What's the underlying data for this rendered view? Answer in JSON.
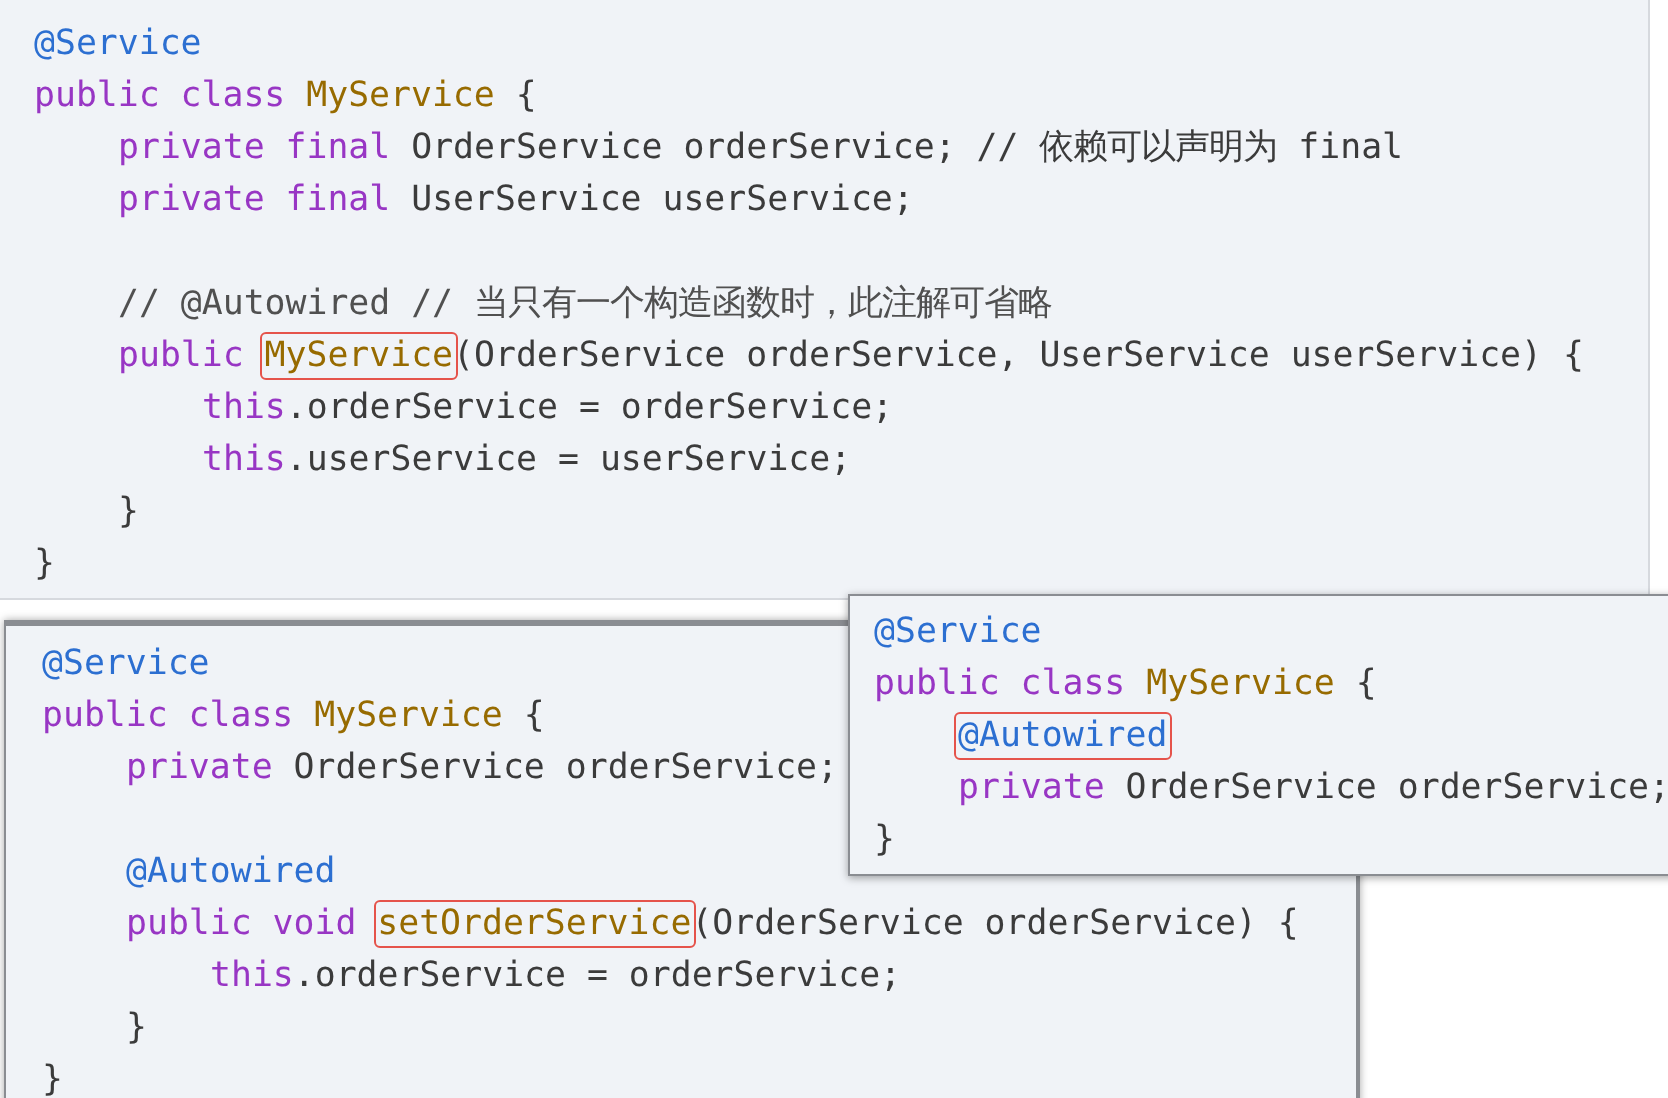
{
  "panels": [
    {
      "lines": [
        {
          "kind": "code",
          "tokens": [
            {
              "text": "@Service",
              "kind": "annotation"
            }
          ]
        },
        {
          "kind": "code",
          "tokens": [
            {
              "text": "public class ",
              "kind": "keyword"
            },
            {
              "text": "MyService",
              "kind": "type"
            },
            {
              "text": " {",
              "kind": "plain"
            }
          ],
          "children": [
            {
              "kind": "code",
              "tokens": [
                {
                  "text": "private final ",
                  "kind": "keyword"
                },
                {
                  "text": "OrderService orderService; // 依赖可以声明为 final",
                  "kind": "plain"
                }
              ]
            },
            {
              "kind": "code",
              "tokens": [
                {
                  "text": "private final ",
                  "kind": "keyword"
                },
                {
                  "text": "UserService userService;",
                  "kind": "plain"
                }
              ]
            },
            {
              "kind": "blank"
            },
            {
              "kind": "code",
              "tokens": [
                {
                  "text": "// @Autowired // 当只有一个构造函数时，此注解可省略",
                  "kind": "comment"
                }
              ]
            },
            {
              "kind": "code",
              "tokens": [
                {
                  "text": "public ",
                  "kind": "keyword"
                },
                {
                  "text": "MyService",
                  "kind": "type",
                  "highlighted": true
                },
                {
                  "text": "(OrderService orderService, UserService userService) {",
                  "kind": "plain"
                }
              ],
              "children": [
                {
                  "kind": "code",
                  "tokens": [
                    {
                      "text": "this",
                      "kind": "keyword"
                    },
                    {
                      "text": ".orderService = orderService;",
                      "kind": "plain"
                    }
                  ]
                },
                {
                  "kind": "code",
                  "tokens": [
                    {
                      "text": "this",
                      "kind": "keyword"
                    },
                    {
                      "text": ".userService = userService;",
                      "kind": "plain"
                    }
                  ]
                }
              ]
            },
            {
              "kind": "code",
              "tokens": [
                {
                  "text": "}",
                  "kind": "plain"
                }
              ]
            }
          ]
        },
        {
          "kind": "code",
          "tokens": [
            {
              "text": "}",
              "kind": "plain"
            }
          ]
        }
      ]
    },
    {
      "lines": [
        {
          "kind": "code",
          "tokens": [
            {
              "text": "@Service",
              "kind": "annotation"
            }
          ]
        },
        {
          "kind": "code",
          "tokens": [
            {
              "text": "public class ",
              "kind": "keyword"
            },
            {
              "text": "MyService",
              "kind": "type"
            },
            {
              "text": " {",
              "kind": "plain"
            }
          ],
          "children": [
            {
              "kind": "code",
              "tokens": [
                {
                  "text": "private ",
                  "kind": "keyword"
                },
                {
                  "text": "OrderService orderService;",
                  "kind": "plain"
                }
              ]
            },
            {
              "kind": "blank"
            },
            {
              "kind": "code",
              "tokens": [
                {
                  "text": "@Autowired",
                  "kind": "annotation"
                }
              ]
            },
            {
              "kind": "code",
              "tokens": [
                {
                  "text": "public void ",
                  "kind": "keyword"
                },
                {
                  "text": "setOrderService",
                  "kind": "type",
                  "highlighted": true
                },
                {
                  "text": "(OrderService orderService) {",
                  "kind": "plain"
                }
              ],
              "children": [
                {
                  "kind": "code",
                  "tokens": [
                    {
                      "text": "this",
                      "kind": "keyword"
                    },
                    {
                      "text": ".orderService = orderService;",
                      "kind": "plain"
                    }
                  ]
                }
              ]
            },
            {
              "kind": "code",
              "tokens": [
                {
                  "text": "}",
                  "kind": "plain"
                }
              ]
            }
          ]
        },
        {
          "kind": "code",
          "tokens": [
            {
              "text": "}",
              "kind": "plain"
            }
          ]
        }
      ]
    },
    {
      "lines": [
        {
          "kind": "code",
          "tokens": [
            {
              "text": "@Service",
              "kind": "annotation"
            }
          ]
        },
        {
          "kind": "code",
          "tokens": [
            {
              "text": "public class ",
              "kind": "keyword"
            },
            {
              "text": "MyService",
              "kind": "type"
            },
            {
              "text": " {",
              "kind": "plain"
            }
          ],
          "children": [
            {
              "kind": "code",
              "tokens": [
                {
                  "text": "@Autowired",
                  "kind": "annotation",
                  "highlighted": true
                }
              ]
            },
            {
              "kind": "code",
              "tokens": [
                {
                  "text": "private ",
                  "kind": "keyword"
                },
                {
                  "text": "OrderService orderService;",
                  "kind": "plain"
                }
              ]
            }
          ]
        },
        {
          "kind": "code",
          "tokens": [
            {
              "text": "}",
              "kind": "plain"
            }
          ]
        }
      ]
    }
  ]
}
